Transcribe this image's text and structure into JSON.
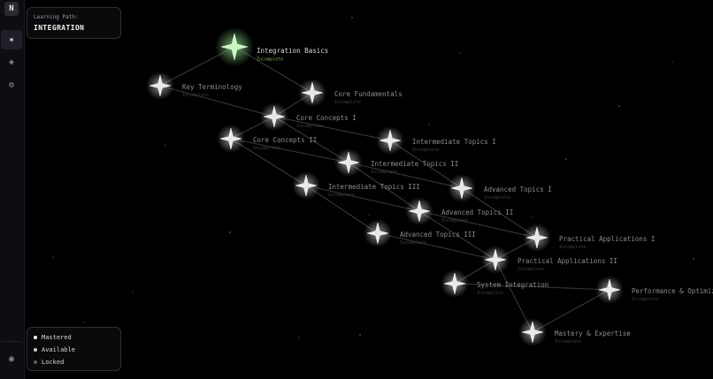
{
  "sidebar": {
    "logo_letter": "N",
    "buttons": [
      {
        "name": "star-icon",
        "glyph": "✶",
        "active": true
      },
      {
        "name": "diamond-icon",
        "glyph": "◈",
        "active": false
      },
      {
        "name": "gear-icon",
        "glyph": "⚙",
        "active": false
      }
    ],
    "bottom_button": {
      "name": "user-icon",
      "glyph": "◉"
    }
  },
  "learning_path": {
    "label": "Learning Path:",
    "title": "INTEGRATION"
  },
  "legend": {
    "items": [
      {
        "label": "Mastered",
        "color": "#ffffff"
      },
      {
        "label": "Available",
        "color": "#cfcfcf"
      },
      {
        "label": "Locked",
        "color": "#5a5a5a"
      }
    ]
  },
  "colors": {
    "active_node": "#c8f5c0",
    "active_glow": "#7be07b",
    "node": "#e9e9e9",
    "edge": "#4a4a4a",
    "status_active": "#7fae52"
  },
  "nodes": [
    {
      "id": "integration-basics",
      "name": "Integration Basics",
      "status": "Incomplete",
      "active": true
    },
    {
      "id": "key-terminology",
      "name": "Key Terminology",
      "status": "Incomplete"
    },
    {
      "id": "core-fundamentals",
      "name": "Core Fundamentals",
      "status": "Incomplete"
    },
    {
      "id": "core-concepts-1",
      "name": "Core Concepts I",
      "status": "Incomplete"
    },
    {
      "id": "core-concepts-2",
      "name": "Core Concepts II",
      "status": "Incomplete"
    },
    {
      "id": "intermediate-topics-1",
      "name": "Intermediate Topics I",
      "status": "Incomplete"
    },
    {
      "id": "intermediate-topics-2",
      "name": "Intermediate Topics II",
      "status": "Incomplete"
    },
    {
      "id": "intermediate-topics-3",
      "name": "Intermediate Topics III",
      "status": "Incomplete"
    },
    {
      "id": "advanced-topics-1",
      "name": "Advanced Topics I",
      "status": "Incomplete"
    },
    {
      "id": "advanced-topics-2",
      "name": "Advanced Topics II",
      "status": "Incomplete"
    },
    {
      "id": "advanced-topics-3",
      "name": "Advanced Topics III",
      "status": "Incomplete"
    },
    {
      "id": "practical-applications-1",
      "name": "Practical Applications I",
      "status": "Incomplete"
    },
    {
      "id": "practical-applications-2",
      "name": "Practical Applications II",
      "status": "Incomplete"
    },
    {
      "id": "system-integration",
      "name": "System Integration",
      "status": "Incomplete"
    },
    {
      "id": "performance-optimization",
      "name": "Performance & Optimization",
      "status": "Incomplete"
    },
    {
      "id": "mastery-expertise",
      "name": "Mastery & Expertise",
      "status": "Incomplete"
    }
  ],
  "edges": [
    [
      "integration-basics",
      "key-terminology"
    ],
    [
      "integration-basics",
      "core-fundamentals"
    ],
    [
      "key-terminology",
      "core-concepts-1"
    ],
    [
      "core-fundamentals",
      "core-concepts-1"
    ],
    [
      "core-concepts-1",
      "core-concepts-2"
    ],
    [
      "core-concepts-1",
      "intermediate-topics-1"
    ],
    [
      "core-concepts-1",
      "intermediate-topics-2"
    ],
    [
      "core-concepts-2",
      "intermediate-topics-2"
    ],
    [
      "core-concepts-2",
      "intermediate-topics-3"
    ],
    [
      "intermediate-topics-1",
      "advanced-topics-1"
    ],
    [
      "intermediate-topics-2",
      "advanced-topics-1"
    ],
    [
      "intermediate-topics-2",
      "advanced-topics-2"
    ],
    [
      "intermediate-topics-3",
      "advanced-topics-2"
    ],
    [
      "intermediate-topics-3",
      "advanced-topics-3"
    ],
    [
      "advanced-topics-1",
      "practical-applications-1"
    ],
    [
      "advanced-topics-2",
      "practical-applications-1"
    ],
    [
      "advanced-topics-2",
      "practical-applications-2"
    ],
    [
      "advanced-topics-3",
      "practical-applications-2"
    ],
    [
      "practical-applications-1",
      "practical-applications-2"
    ],
    [
      "practical-applications-2",
      "system-integration"
    ],
    [
      "practical-applications-2",
      "mastery-expertise"
    ],
    [
      "system-integration",
      "performance-optimization"
    ],
    [
      "performance-optimization",
      "mastery-expertise"
    ]
  ]
}
